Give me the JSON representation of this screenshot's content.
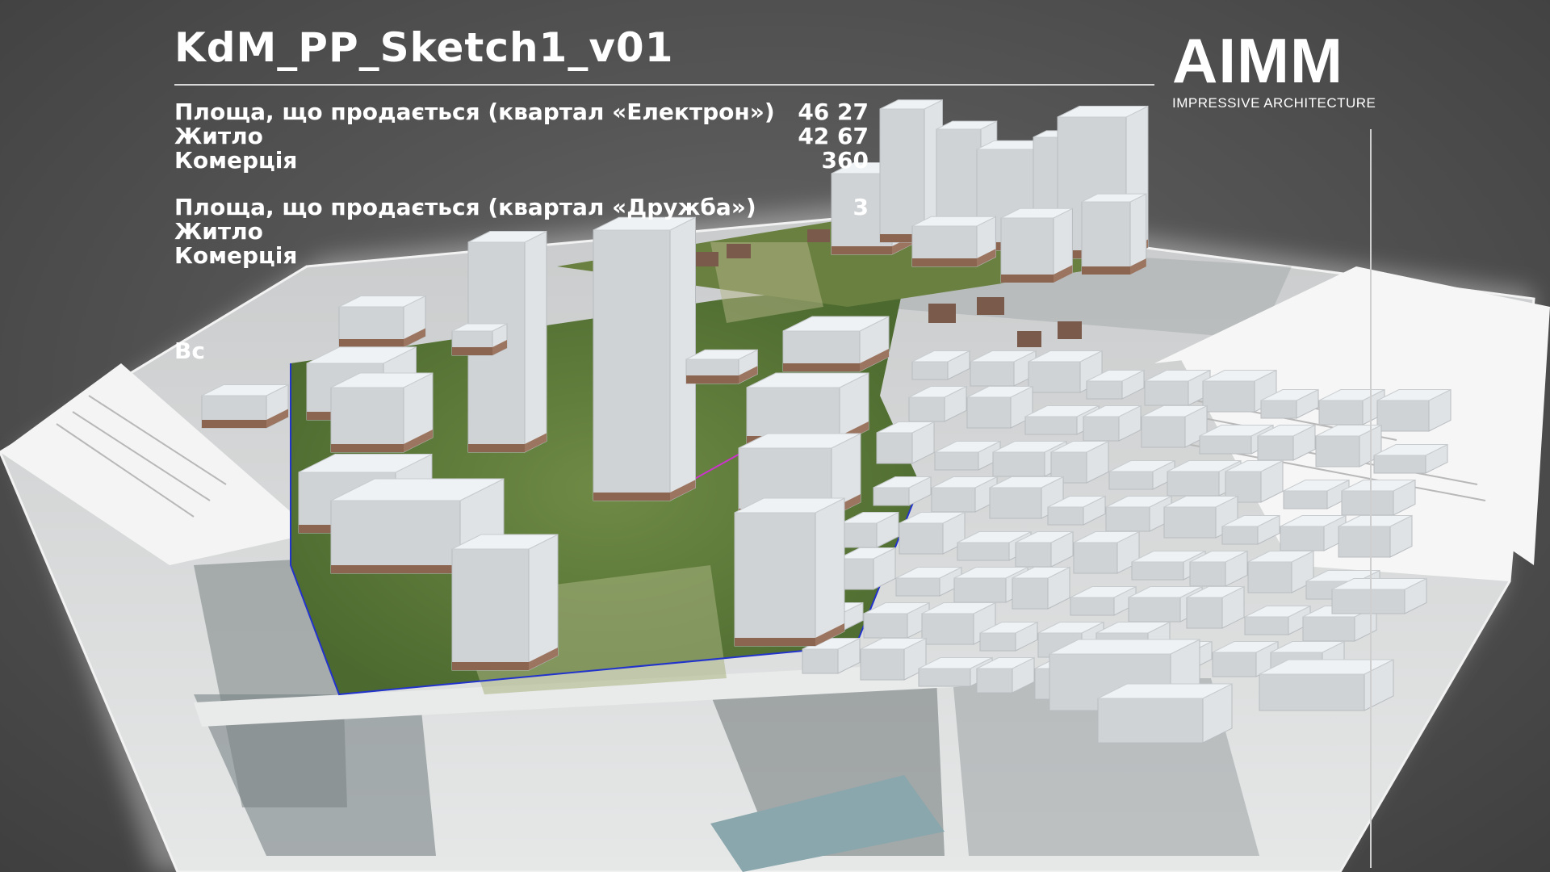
{
  "header": {
    "title": "KdM_PP_Sketch1_v01",
    "stats": [
      {
        "label": "Площа, що продається (квартал «Електрон»)",
        "value": "46 27"
      },
      {
        "label": "Житло",
        "value": "42 67"
      },
      {
        "label": "Комерція",
        "value": "360"
      },
      {
        "label": "",
        "value": ""
      },
      {
        "label": "Площа, що продається (квартал «Дружба»)",
        "value": "3"
      },
      {
        "label": "Житло",
        "value": ""
      },
      {
        "label": "Комерція",
        "value": ""
      }
    ],
    "partial_label": "Вс"
  },
  "logo": {
    "name": "AIMM",
    "tagline": "IMPRESSIVE ARCHITECTURE"
  },
  "colors": {
    "background": "#555555",
    "text": "#ffffff",
    "green_site": "#5f7a3a",
    "building_top": "#eef2f4",
    "building_side": "#cfd3d6",
    "building_base": "#8b6550",
    "boundary_blue": "#2233cc",
    "boundary_magenta": "#cc33cc"
  }
}
